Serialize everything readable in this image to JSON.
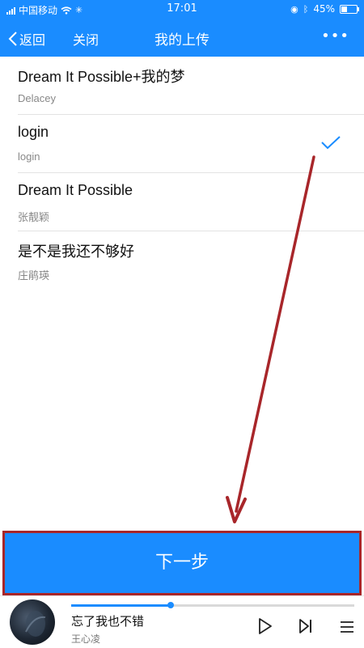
{
  "status_bar": {
    "carrier": "中国移动",
    "time": "17:01",
    "battery": "45%",
    "battery_level": 0.45
  },
  "nav": {
    "back_label": "返回",
    "close_label": "关闭",
    "title": "我的上传",
    "more_label": "•••"
  },
  "songs": [
    {
      "title": "Dream It Possible+我的梦",
      "artist": "Delacey",
      "selected": false
    },
    {
      "title": "login",
      "artist": "login",
      "selected": true
    },
    {
      "title": "Dream It Possible",
      "artist": "张靓颖",
      "selected": false
    },
    {
      "title": "是不是我还不够好",
      "artist": "庄鹃瑛",
      "selected": false
    }
  ],
  "next_button": {
    "label": "下一步"
  },
  "player": {
    "song": "忘了我也不错",
    "artist": "王心凌",
    "progress": 0.35
  },
  "colors": {
    "accent": "#1a8cff",
    "annotation": "#a8262a"
  },
  "icons": {
    "back": "chevron-left-icon",
    "more": "more-dots-icon",
    "check": "checkmark-icon",
    "play": "play-icon",
    "next": "next-track-icon",
    "playlist": "playlist-icon"
  }
}
